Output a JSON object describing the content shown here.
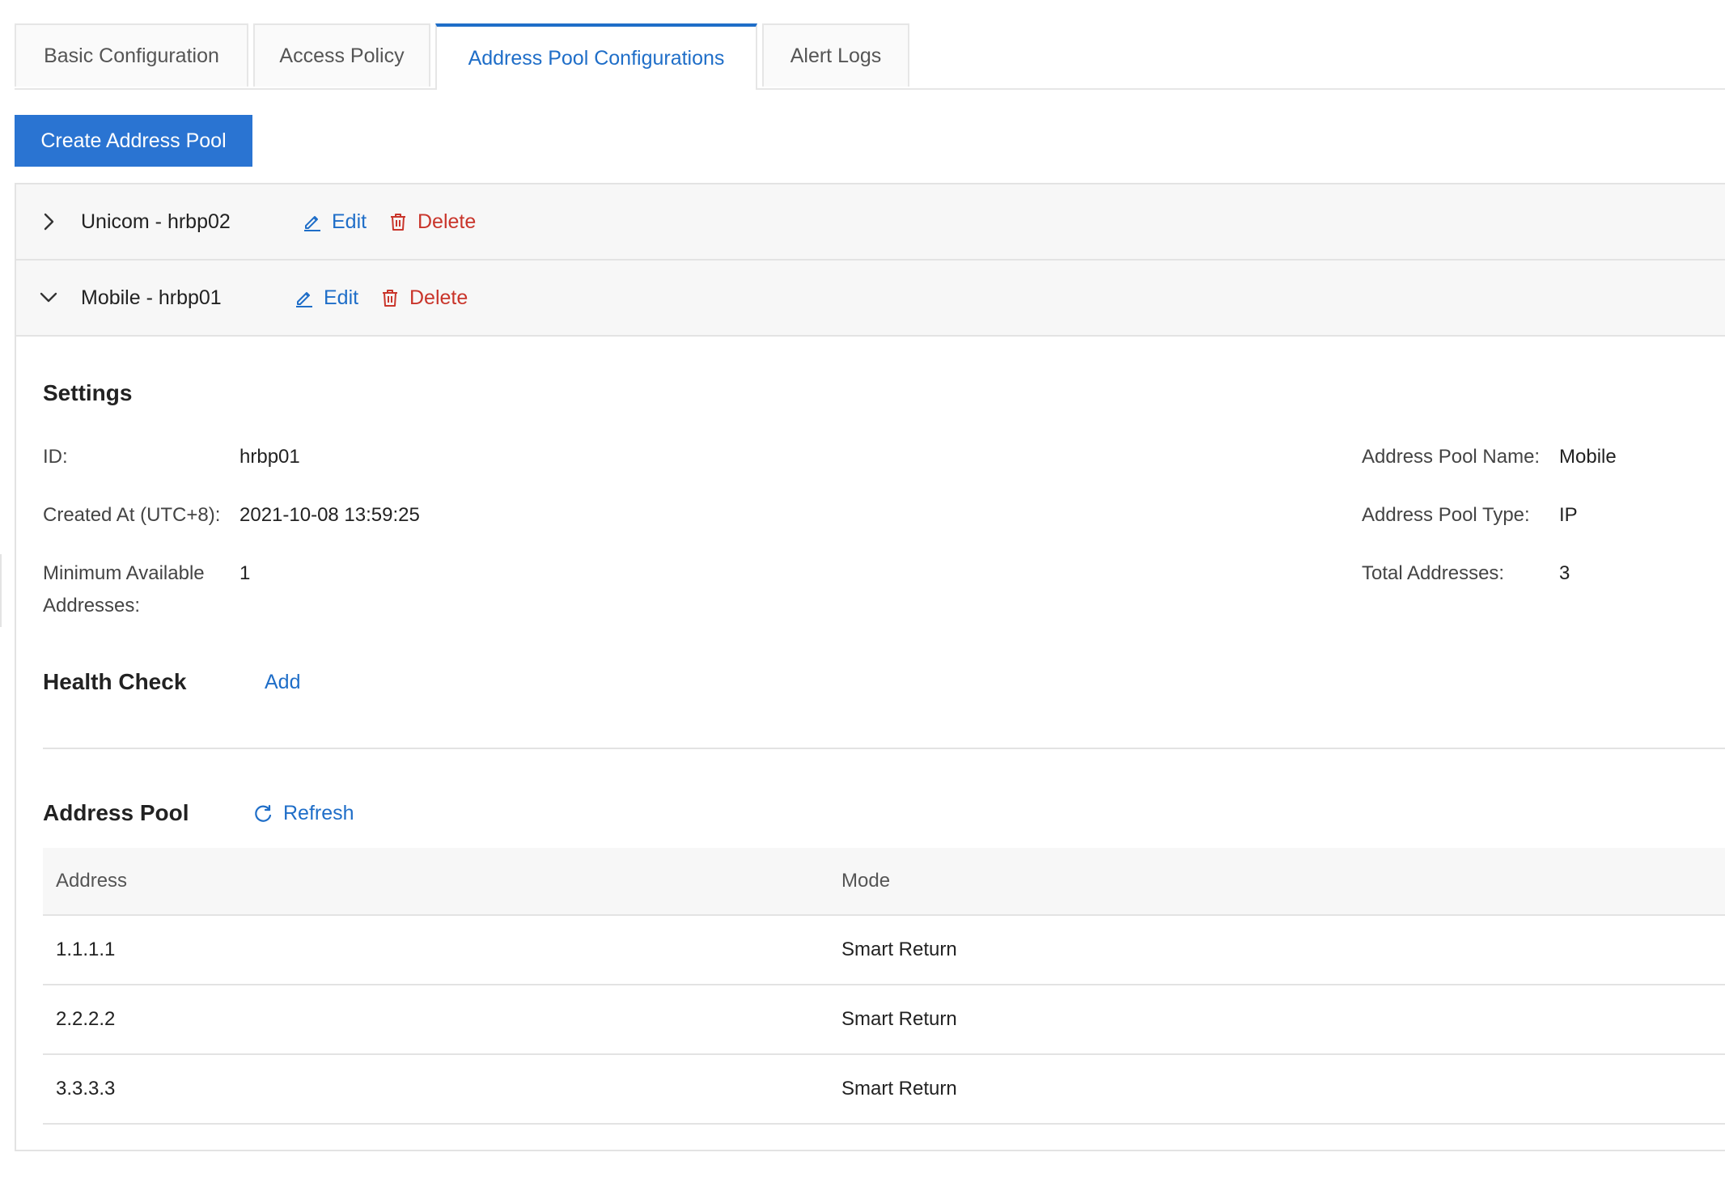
{
  "tabs": [
    {
      "label": "Basic Configuration",
      "active": false
    },
    {
      "label": "Access Policy",
      "active": false
    },
    {
      "label": "Address Pool Configurations",
      "active": true
    },
    {
      "label": "Alert Logs",
      "active": false
    }
  ],
  "create_button_label": "Create Address Pool",
  "pools": [
    {
      "name": "Unicom - hrbp02",
      "expanded": false,
      "edit_label": "Edit",
      "delete_label": "Delete"
    },
    {
      "name": "Mobile - hrbp01",
      "expanded": true,
      "edit_label": "Edit",
      "delete_label": "Delete"
    }
  ],
  "settings": {
    "title": "Settings",
    "id_label": "ID:",
    "id_value": "hrbp01",
    "created_label": "Created At (UTC+8):",
    "created_value": "2021-10-08 13:59:25",
    "min_label_line1": "Minimum Available",
    "min_label_line2": "Addresses:",
    "min_value": "1",
    "name_label": "Address Pool Name:",
    "name_value": "Mobile",
    "type_label": "Address Pool Type:",
    "type_value": "IP",
    "total_label": "Total Addresses:",
    "total_value": "3"
  },
  "health_check": {
    "title": "Health Check",
    "add_label": "Add"
  },
  "address_pool": {
    "title": "Address Pool",
    "refresh_label": "Refresh",
    "columns": [
      "Address",
      "Mode"
    ],
    "rows": [
      {
        "address": "1.1.1.1",
        "mode": "Smart Return"
      },
      {
        "address": "2.2.2.2",
        "mode": "Smart Return"
      },
      {
        "address": "3.3.3.3",
        "mode": "Smart Return"
      }
    ]
  },
  "colors": {
    "accent": "#1f6ec8",
    "primary_button": "#2a74d2",
    "danger": "#c9352b"
  }
}
